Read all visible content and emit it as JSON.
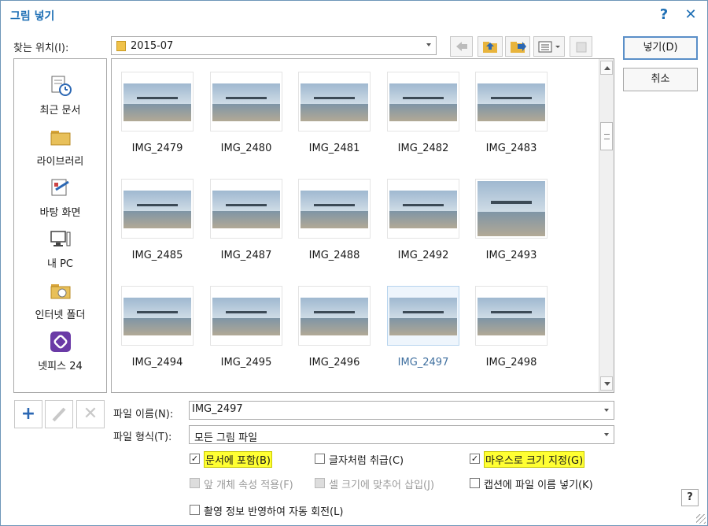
{
  "window": {
    "title": "그림 넣기",
    "help_glyph": "?",
    "close_glyph": "✕"
  },
  "location": {
    "label": "찾는 위치(I):",
    "value": "2015-07"
  },
  "buttons": {
    "insert": "넣기(D)",
    "cancel": "취소"
  },
  "places": [
    {
      "label": "최근 문서",
      "icon": "recent-docs-icon"
    },
    {
      "label": "라이브러리",
      "icon": "library-folder-icon"
    },
    {
      "label": "바탕 화면",
      "icon": "desktop-icon"
    },
    {
      "label": "내 PC",
      "icon": "computer-icon"
    },
    {
      "label": "인터넷 폴더",
      "icon": "internet-folder-icon"
    },
    {
      "label": "넷피스 24",
      "icon": "netffice-icon"
    }
  ],
  "files": [
    {
      "name": "IMG_2479"
    },
    {
      "name": "IMG_2480"
    },
    {
      "name": "IMG_2481"
    },
    {
      "name": "IMG_2482"
    },
    {
      "name": "IMG_2483"
    },
    {
      "name": "IMG_2485"
    },
    {
      "name": "IMG_2487"
    },
    {
      "name": "IMG_2488"
    },
    {
      "name": "IMG_2492"
    },
    {
      "name": "IMG_2493"
    },
    {
      "name": "IMG_2494"
    },
    {
      "name": "IMG_2495"
    },
    {
      "name": "IMG_2496"
    },
    {
      "name": "IMG_2497"
    },
    {
      "name": "IMG_2498"
    }
  ],
  "selected_file": "IMG_2497",
  "filename": {
    "label": "파일 이름(N):",
    "value": "IMG_2497"
  },
  "filetype": {
    "label": "파일 형식(T):",
    "value": "모든 그림 파일"
  },
  "options": {
    "include_in_doc": {
      "label": "문서에 포함(B)",
      "checked": true,
      "highlight": true
    },
    "treat_as_char": {
      "label": "글자처럼 취급(C)",
      "checked": false
    },
    "mouse_size": {
      "label": "마우스로 크기 지정(G)",
      "checked": true,
      "highlight": true
    },
    "apply_prev_props": {
      "label": "앞 개체 속성 적용(F)",
      "checked": false,
      "disabled": true
    },
    "fit_cell": {
      "label": "셀 크기에 맞추어 삽입(J)",
      "checked": false,
      "disabled": true
    },
    "caption_name": {
      "label": "캡션에 파일 이름 넣기(K)",
      "checked": false
    },
    "auto_rotate": {
      "label": "촬영 정보 반영하여 자동 회전(L)",
      "checked": false
    }
  },
  "help_button": "?",
  "colors": {
    "accent": "#1e6fb5",
    "highlight": "#ffff33"
  }
}
